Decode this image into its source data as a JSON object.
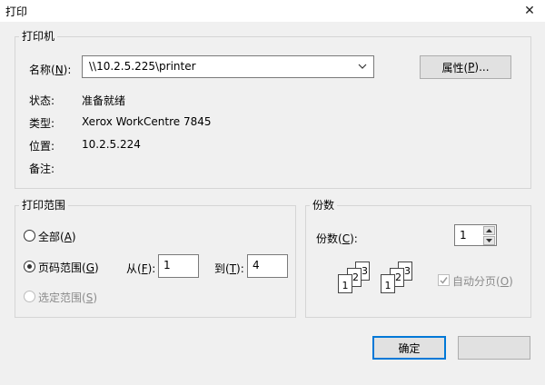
{
  "window": {
    "title": "打印",
    "close_glyph": "✕"
  },
  "printer": {
    "group_title": "打印机",
    "name_label": "名称(",
    "name_key": "N",
    "name_suffix": "):",
    "name_value": "\\\\10.2.5.225\\printer",
    "properties_label": "属性(",
    "properties_key": "P",
    "properties_suffix": ")...",
    "status_label": "状态:",
    "status_value": "准备就绪",
    "type_label": "类型:",
    "type_value": "Xerox WorkCentre 7845",
    "location_label": "位置:",
    "location_value": "10.2.5.224",
    "comment_label": "备注:",
    "comment_value": ""
  },
  "range": {
    "group_title": "打印范围",
    "all_label": "全部(",
    "all_key": "A",
    "all_suffix": ")",
    "pages_label": "页码范围(",
    "pages_key": "G",
    "pages_suffix": ")",
    "from_label": "从(",
    "from_key": "F",
    "from_suffix": "):",
    "from_value": "1",
    "to_label": "到(",
    "to_key": "T",
    "to_suffix": "):",
    "to_value": "4",
    "selection_label": "选定范围(",
    "selection_key": "S",
    "selection_suffix": ")",
    "selected": "pages"
  },
  "copies": {
    "group_title": "份数",
    "count_label": "份数(",
    "count_key": "C",
    "count_suffix": "):",
    "count_value": "1",
    "collate_label": "自动分页(",
    "collate_key": "O",
    "collate_suffix": ")",
    "collate_checked": true,
    "collate_enabled": false,
    "page_numbers": [
      "1",
      "2",
      "3"
    ]
  },
  "buttons": {
    "ok_label": "确定",
    "cancel_label": ""
  }
}
